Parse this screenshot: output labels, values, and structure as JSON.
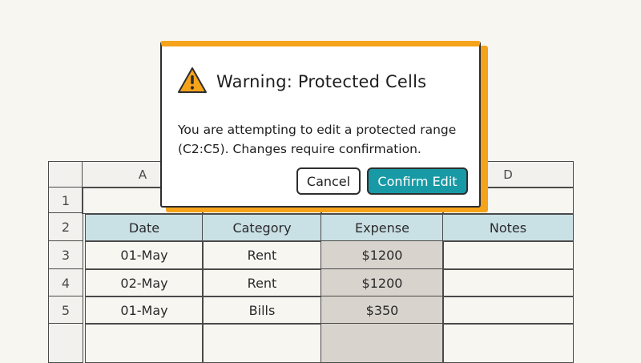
{
  "dialog": {
    "title": "Warning: Protected Cells",
    "message": "You are attempting to edit a protected range (C2:C5). Changes require confirmation.",
    "cancel_label": "Cancel",
    "confirm_label": "Confirm Edit",
    "icon": "warning-triangle-icon",
    "accent_color": "#f5a31a",
    "confirm_color": "#189aa6"
  },
  "sheet": {
    "column_headers": [
      "A",
      "D"
    ],
    "row_numbers": [
      "1",
      "2",
      "3",
      "4",
      "5"
    ],
    "table_headers": [
      "Date",
      "Category",
      "Expense",
      "Notes"
    ],
    "rows": [
      [
        "01-May",
        "Rent",
        "$1200",
        ""
      ],
      [
        "02-May",
        "Rent",
        "$1200",
        ""
      ],
      [
        "01-May",
        "Bills",
        "$350",
        ""
      ]
    ],
    "header_fill_color": "#c9e0e5",
    "protected_fill_color": "#d8d3cd"
  }
}
